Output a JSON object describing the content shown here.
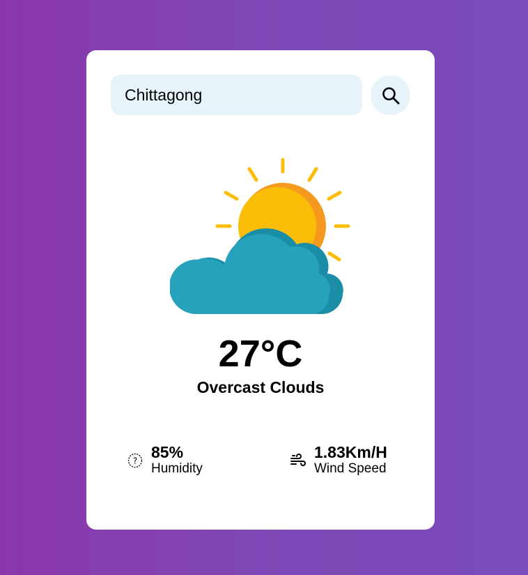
{
  "search": {
    "value": "Chittagong",
    "button_icon": "search-icon"
  },
  "weather": {
    "icon": "partly-cloudy-sun-icon",
    "temperature": "27°C",
    "condition": "Overcast Clouds"
  },
  "details": {
    "humidity": {
      "value": "85%",
      "label": "Humidity",
      "icon": "humidity-icon"
    },
    "wind": {
      "value": "1.83Km/H",
      "label": "Wind Speed",
      "icon": "wind-icon"
    }
  },
  "colors": {
    "background_start": "#8a37ab",
    "background_end": "#7b4cba",
    "card": "#ffffff",
    "input_bg": "#e6f4fa",
    "sun": "#fbbd08",
    "sun_shade": "#f69a1f",
    "cloud": "#27a2bd",
    "cloud_shade": "#1b8ea7"
  }
}
